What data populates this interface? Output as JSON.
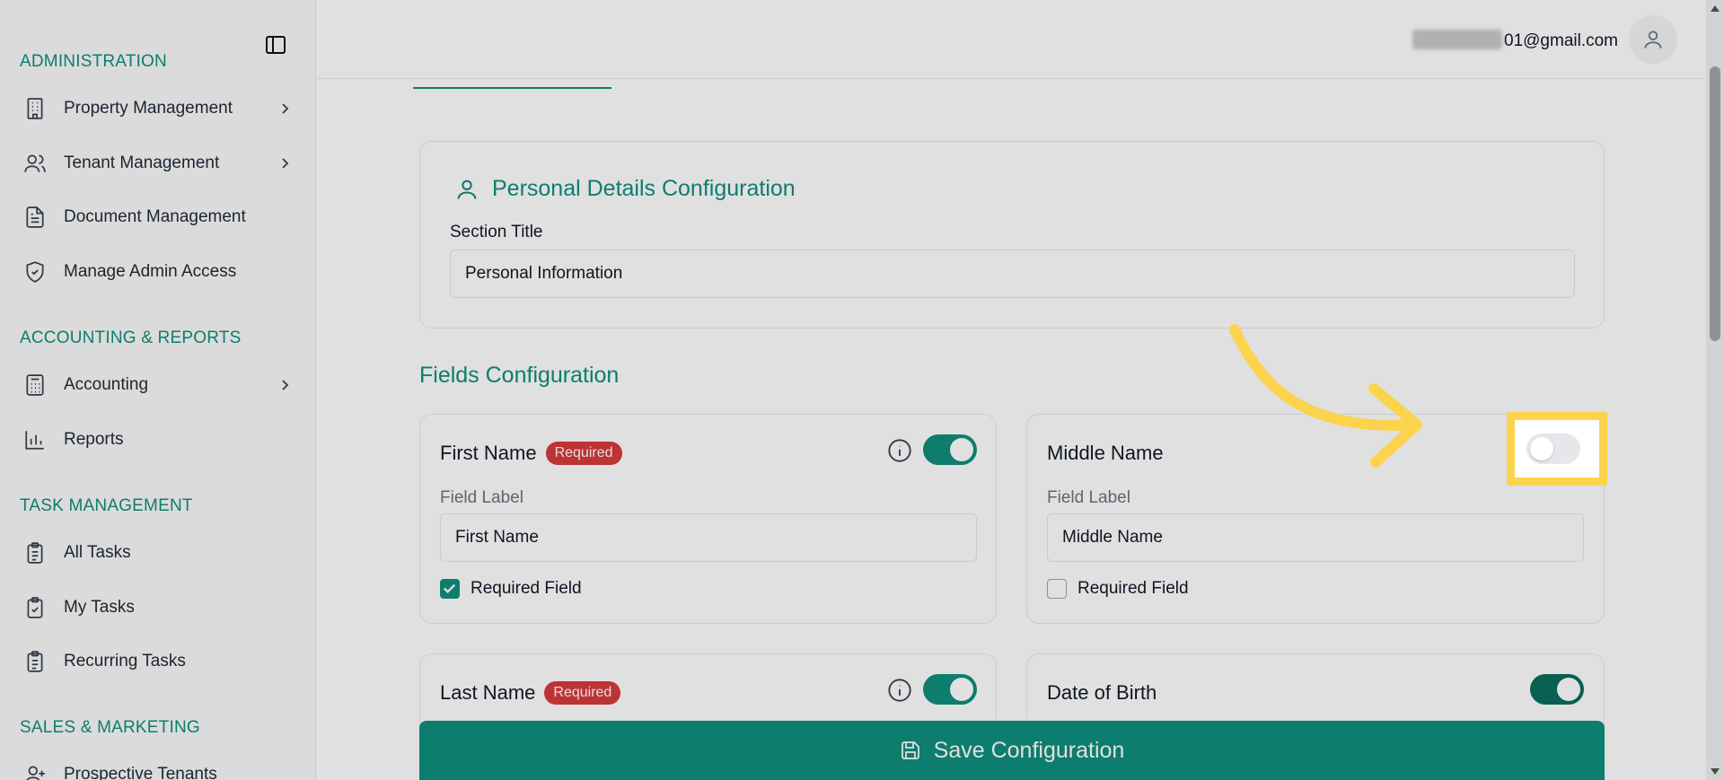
{
  "sidebar": {
    "sections": [
      {
        "label": "ADMINISTRATION"
      },
      {
        "label": "ACCOUNTING & REPORTS"
      },
      {
        "label": "TASK MANAGEMENT"
      },
      {
        "label": "SALES & MARKETING"
      }
    ],
    "items": [
      {
        "label": "Property Management",
        "icon": "building-icon"
      },
      {
        "label": "Tenant Management",
        "icon": "users-icon"
      },
      {
        "label": "Document Management",
        "icon": "document-icon"
      },
      {
        "label": "Manage Admin Access",
        "icon": "shield-check-icon"
      },
      {
        "label": "Accounting",
        "icon": "calculator-icon"
      },
      {
        "label": "Reports",
        "icon": "bar-chart-icon"
      },
      {
        "label": "All Tasks",
        "icon": "clipboard-list-icon"
      },
      {
        "label": "My Tasks",
        "icon": "clipboard-check-icon"
      },
      {
        "label": "Recurring Tasks",
        "icon": "clipboard-list-icon"
      },
      {
        "label": "Prospective Tenants",
        "icon": "user-plus-icon"
      }
    ]
  },
  "header": {
    "user_email_visible": "01@gmail.com"
  },
  "personal_details": {
    "title": "Personal Details Configuration",
    "section_title_label": "Section Title",
    "section_title_value": "Personal Information"
  },
  "fields": {
    "heading": "Fields Configuration",
    "required_badge": "Required",
    "field_label_text": "Field Label",
    "required_field_text": "Required Field",
    "items": [
      {
        "name": "First Name",
        "label_value": "First Name",
        "required": true,
        "enabled": true
      },
      {
        "name": "Middle Name",
        "label_value": "Middle Name",
        "required": false,
        "enabled": false
      },
      {
        "name": "Last Name",
        "required": true,
        "enabled": true
      },
      {
        "name": "Date of Birth",
        "required": false,
        "enabled": true
      }
    ]
  },
  "save_button": {
    "label": "Save Configuration"
  },
  "colors": {
    "accent": "#0f8f7d",
    "required_badge": "#d93b3b",
    "highlight": "#fcd34d"
  }
}
